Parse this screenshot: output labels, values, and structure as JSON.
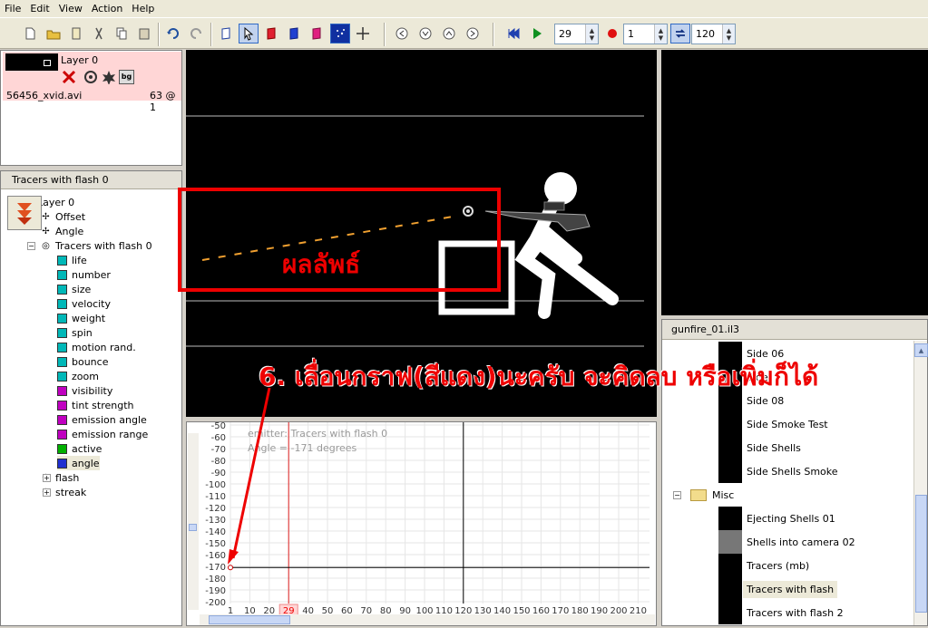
{
  "menu": [
    "File",
    "Edit",
    "View",
    "Action",
    "Help"
  ],
  "toolbar": {
    "frame_value": "29",
    "step_value": "1",
    "end_value": "120"
  },
  "layer_panel": {
    "layer_name": "Layer 0",
    "file_name": "56456_xvid.avi",
    "frame_info": "63 @ 1"
  },
  "tree": {
    "header": "Tracers with flash 0",
    "items": [
      {
        "label": "Layer 0",
        "indent": 0,
        "icon": "layer-icon"
      },
      {
        "label": "Offset",
        "indent": 1,
        "icon": "offset-icon"
      },
      {
        "label": "Angle",
        "indent": 1,
        "icon": "angle-icon"
      },
      {
        "label": "Tracers with flash 0",
        "indent": 1,
        "icon": "emitter-icon"
      },
      {
        "label": "life",
        "indent": 2,
        "color": "cyan"
      },
      {
        "label": "number",
        "indent": 2,
        "color": "cyan"
      },
      {
        "label": "size",
        "indent": 2,
        "color": "cyan"
      },
      {
        "label": "velocity",
        "indent": 2,
        "color": "cyan"
      },
      {
        "label": "weight",
        "indent": 2,
        "color": "cyan"
      },
      {
        "label": "spin",
        "indent": 2,
        "color": "cyan"
      },
      {
        "label": "motion rand.",
        "indent": 2,
        "color": "cyan"
      },
      {
        "label": "bounce",
        "indent": 2,
        "color": "cyan"
      },
      {
        "label": "zoom",
        "indent": 2,
        "color": "cyan"
      },
      {
        "label": "visibility",
        "indent": 2,
        "color": "mag"
      },
      {
        "label": "tint strength",
        "indent": 2,
        "color": "mag"
      },
      {
        "label": "emission angle",
        "indent": 2,
        "color": "mag"
      },
      {
        "label": "emission range",
        "indent": 2,
        "color": "mag"
      },
      {
        "label": "active",
        "indent": 2,
        "color": "grn"
      },
      {
        "label": "angle",
        "indent": 2,
        "color": "blu"
      },
      {
        "label": "flash",
        "indent": 1,
        "icon": "particle-icon"
      },
      {
        "label": "streak",
        "indent": 1,
        "icon": "particle-icon"
      }
    ]
  },
  "graph": {
    "info_emitter": "emitter: Tracers with flash 0",
    "info_angle": "Angle = -171 degrees",
    "y_ticks": [
      "-50",
      "-60",
      "-70",
      "-80",
      "-90",
      "-100",
      "-110",
      "-120",
      "-130",
      "-140",
      "-150",
      "-160",
      "-170",
      "-180",
      "-190",
      "-200"
    ],
    "x_ticks": [
      "1",
      "10",
      "20",
      "29",
      "40",
      "50",
      "60",
      "70",
      "80",
      "90",
      "100",
      "110",
      "120",
      "130",
      "140",
      "150",
      "160",
      "170",
      "180",
      "190",
      "200",
      "210"
    ],
    "current_frame": "29"
  },
  "library": {
    "header": "gunfire_01.il3",
    "items": [
      {
        "label": "Side 06",
        "folder": false
      },
      {
        "label": "Side",
        "folder": false
      },
      {
        "label": "Side 08",
        "folder": false
      },
      {
        "label": "Side Smoke Test",
        "folder": false
      },
      {
        "label": "Side Shells",
        "folder": false
      },
      {
        "label": "Side Shells Smoke",
        "folder": false
      },
      {
        "label": "Misc",
        "folder": true
      },
      {
        "label": "Ejecting Shells 01",
        "folder": false
      },
      {
        "label": "Shells into camera 02",
        "folder": false
      },
      {
        "label": "Tracers (mb)",
        "folder": false
      },
      {
        "label": "Tracers with flash",
        "folder": false,
        "selected": true
      },
      {
        "label": "Tracers with flash 2",
        "folder": false
      }
    ]
  },
  "annotation": {
    "result_label": "ผลลัพธ์",
    "instruction": "6. เลื่อนกราฟ(สีแดง)นะครับ จะคิดลบ หรือเพิ่มก็ได้"
  },
  "colors": {
    "annotation": "#e00000",
    "selection_pink": "#ffd6d6"
  }
}
